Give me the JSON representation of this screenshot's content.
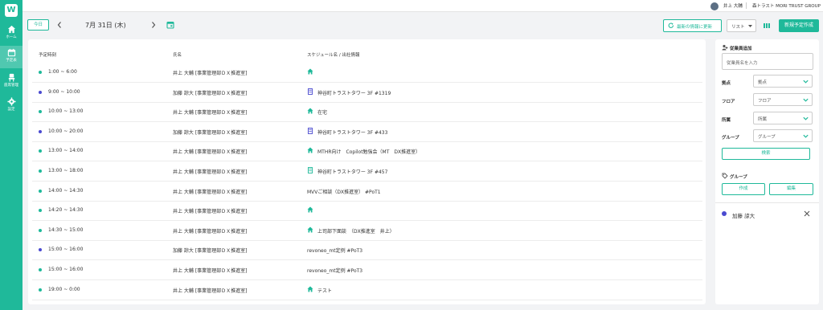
{
  "nav": {
    "logo": "W",
    "items": [
      {
        "label": "ホーム",
        "icon": "home-icon"
      },
      {
        "label": "予定表",
        "icon": "calendar-icon"
      },
      {
        "label": "座席管理",
        "icon": "seat-icon"
      },
      {
        "label": "設定",
        "icon": "gear-icon"
      }
    ]
  },
  "topbar": {
    "user_name": "井上 大輔",
    "company": "森トラスト MORI TRUST GROUP"
  },
  "toolbar": {
    "today": "今日",
    "date": "7月 31日 (木)",
    "refresh": "最新の情報に更新",
    "view": "リスト",
    "new_schedule": "新規予定作成"
  },
  "table": {
    "headers": [
      "予定時刻",
      "氏名",
      "スケジュール名 / 出社情報"
    ],
    "rows": [
      {
        "time": "1:00 ~ 6:00",
        "name": "井上 大輔 [事業管理部ＤＸ推進室]",
        "schedule": "",
        "icon": "home-icon",
        "dot": "#1fb99a"
      },
      {
        "time": "9:00 ~ 10:00",
        "name": "加藤 諒大 [事業管理部ＤＸ推進室]",
        "schedule": "神谷町トラストタワー 3F #1319",
        "icon": "building-icon",
        "dot": "#4a4ad0"
      },
      {
        "time": "10:00 ~ 13:00",
        "name": "井上 大輔 [事業管理部ＤＸ推進室]",
        "schedule": "在宅",
        "icon": "home-icon",
        "dot": "#1fb99a"
      },
      {
        "time": "10:00 ~ 20:00",
        "name": "加藤 諒大 [事業管理部ＤＸ推進室]",
        "schedule": "神谷町トラストタワー 3F #433",
        "icon": "building-icon",
        "dot": "#4a4ad0"
      },
      {
        "time": "13:00 ~ 14:00",
        "name": "井上 大輔 [事業管理部ＤＸ推進室]",
        "schedule": "MTHR向け　Copilot勉強会（MT　DX推進室）",
        "icon": "home-icon",
        "dot": "#1fb99a"
      },
      {
        "time": "13:00 ~ 18:00",
        "name": "井上 大輔 [事業管理部ＤＸ推進室]",
        "schedule": "神谷町トラストタワー 3F #457",
        "icon": "building-icon",
        "dot": "#1fb99a"
      },
      {
        "time": "14:00 ~ 14:30",
        "name": "井上 大輔 [事業管理部ＤＸ推進室]",
        "schedule": "MVVご相談（DX推進室） #PoT1",
        "icon": "",
        "dot": "#1fb99a"
      },
      {
        "time": "14:20 ~ 14:30",
        "name": "井上 大輔 [事業管理部ＤＸ推進室]",
        "schedule": "",
        "icon": "home-icon",
        "dot": "#1fb99a"
      },
      {
        "time": "14:30 ~ 15:00",
        "name": "井上 大輔 [事業管理部ＤＸ推進室]",
        "schedule": "上司部下面談　（DX推進室　井上）",
        "icon": "home-icon",
        "dot": "#1fb99a"
      },
      {
        "time": "15:00 ~ 16:00",
        "name": "加藤 諒大 [事業管理部ＤＸ推進室]",
        "schedule": "revoneo_mt定例 #PoT3",
        "icon": "",
        "dot": "#4a4ad0"
      },
      {
        "time": "15:00 ~ 16:00",
        "name": "井上 大輔 [事業管理部ＤＸ推進室]",
        "schedule": "revoneo_mt定例 #PoT3",
        "icon": "",
        "dot": "#1fb99a"
      },
      {
        "time": "19:00 ~ 0:00",
        "name": "井上 大輔 [事業管理部ＤＸ推進室]",
        "schedule": "テスト",
        "icon": "home-icon",
        "dot": "#1fb99a"
      }
    ]
  },
  "side": {
    "add_employee": "従業員追加",
    "search_placeholder": "従業員名を入力",
    "filters": [
      {
        "label": "拠点",
        "value": "拠点"
      },
      {
        "label": "フロア",
        "value": "フロア"
      },
      {
        "label": "所属",
        "value": "所属"
      },
      {
        "label": "グループ",
        "value": "グループ"
      }
    ],
    "search_button": "検索",
    "group_title": "グループ",
    "create_button": "作成",
    "edit_button": "編集",
    "members": [
      {
        "name": "加藤 諒大",
        "color": "#4a4ad0"
      }
    ]
  },
  "colors": {
    "accent": "#1fb99a",
    "member_blue": "#4a4ad0"
  }
}
